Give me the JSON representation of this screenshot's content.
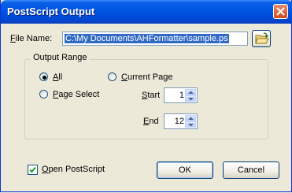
{
  "window": {
    "title": "PostScript Output"
  },
  "icons": {
    "close": "close-icon",
    "browse": "folder-open-icon",
    "check": "checkmark-icon"
  },
  "file": {
    "label_first": "F",
    "label_rest": "ile Name:",
    "value": "C:\\My Documents\\AHFormatter\\sample.ps"
  },
  "range": {
    "title": "Output Range",
    "all_first": "A",
    "all_rest": "ll",
    "current_first": "C",
    "current_rest": "urrent Page",
    "select_first": "P",
    "select_rest": "age Select",
    "start_first": "S",
    "start_rest": "tart",
    "end_first": "E",
    "end_rest": "nd",
    "start_value": "1",
    "end_value": "12",
    "selected": "All"
  },
  "open_ps": {
    "first": "O",
    "rest": "pen PostScript",
    "checked": true
  },
  "buttons": {
    "ok": "OK",
    "cancel": "Cancel"
  },
  "colors": {
    "title_bar": "#0054e3",
    "selection": "#316ac5",
    "dialog_bg": "#ece9d8"
  }
}
